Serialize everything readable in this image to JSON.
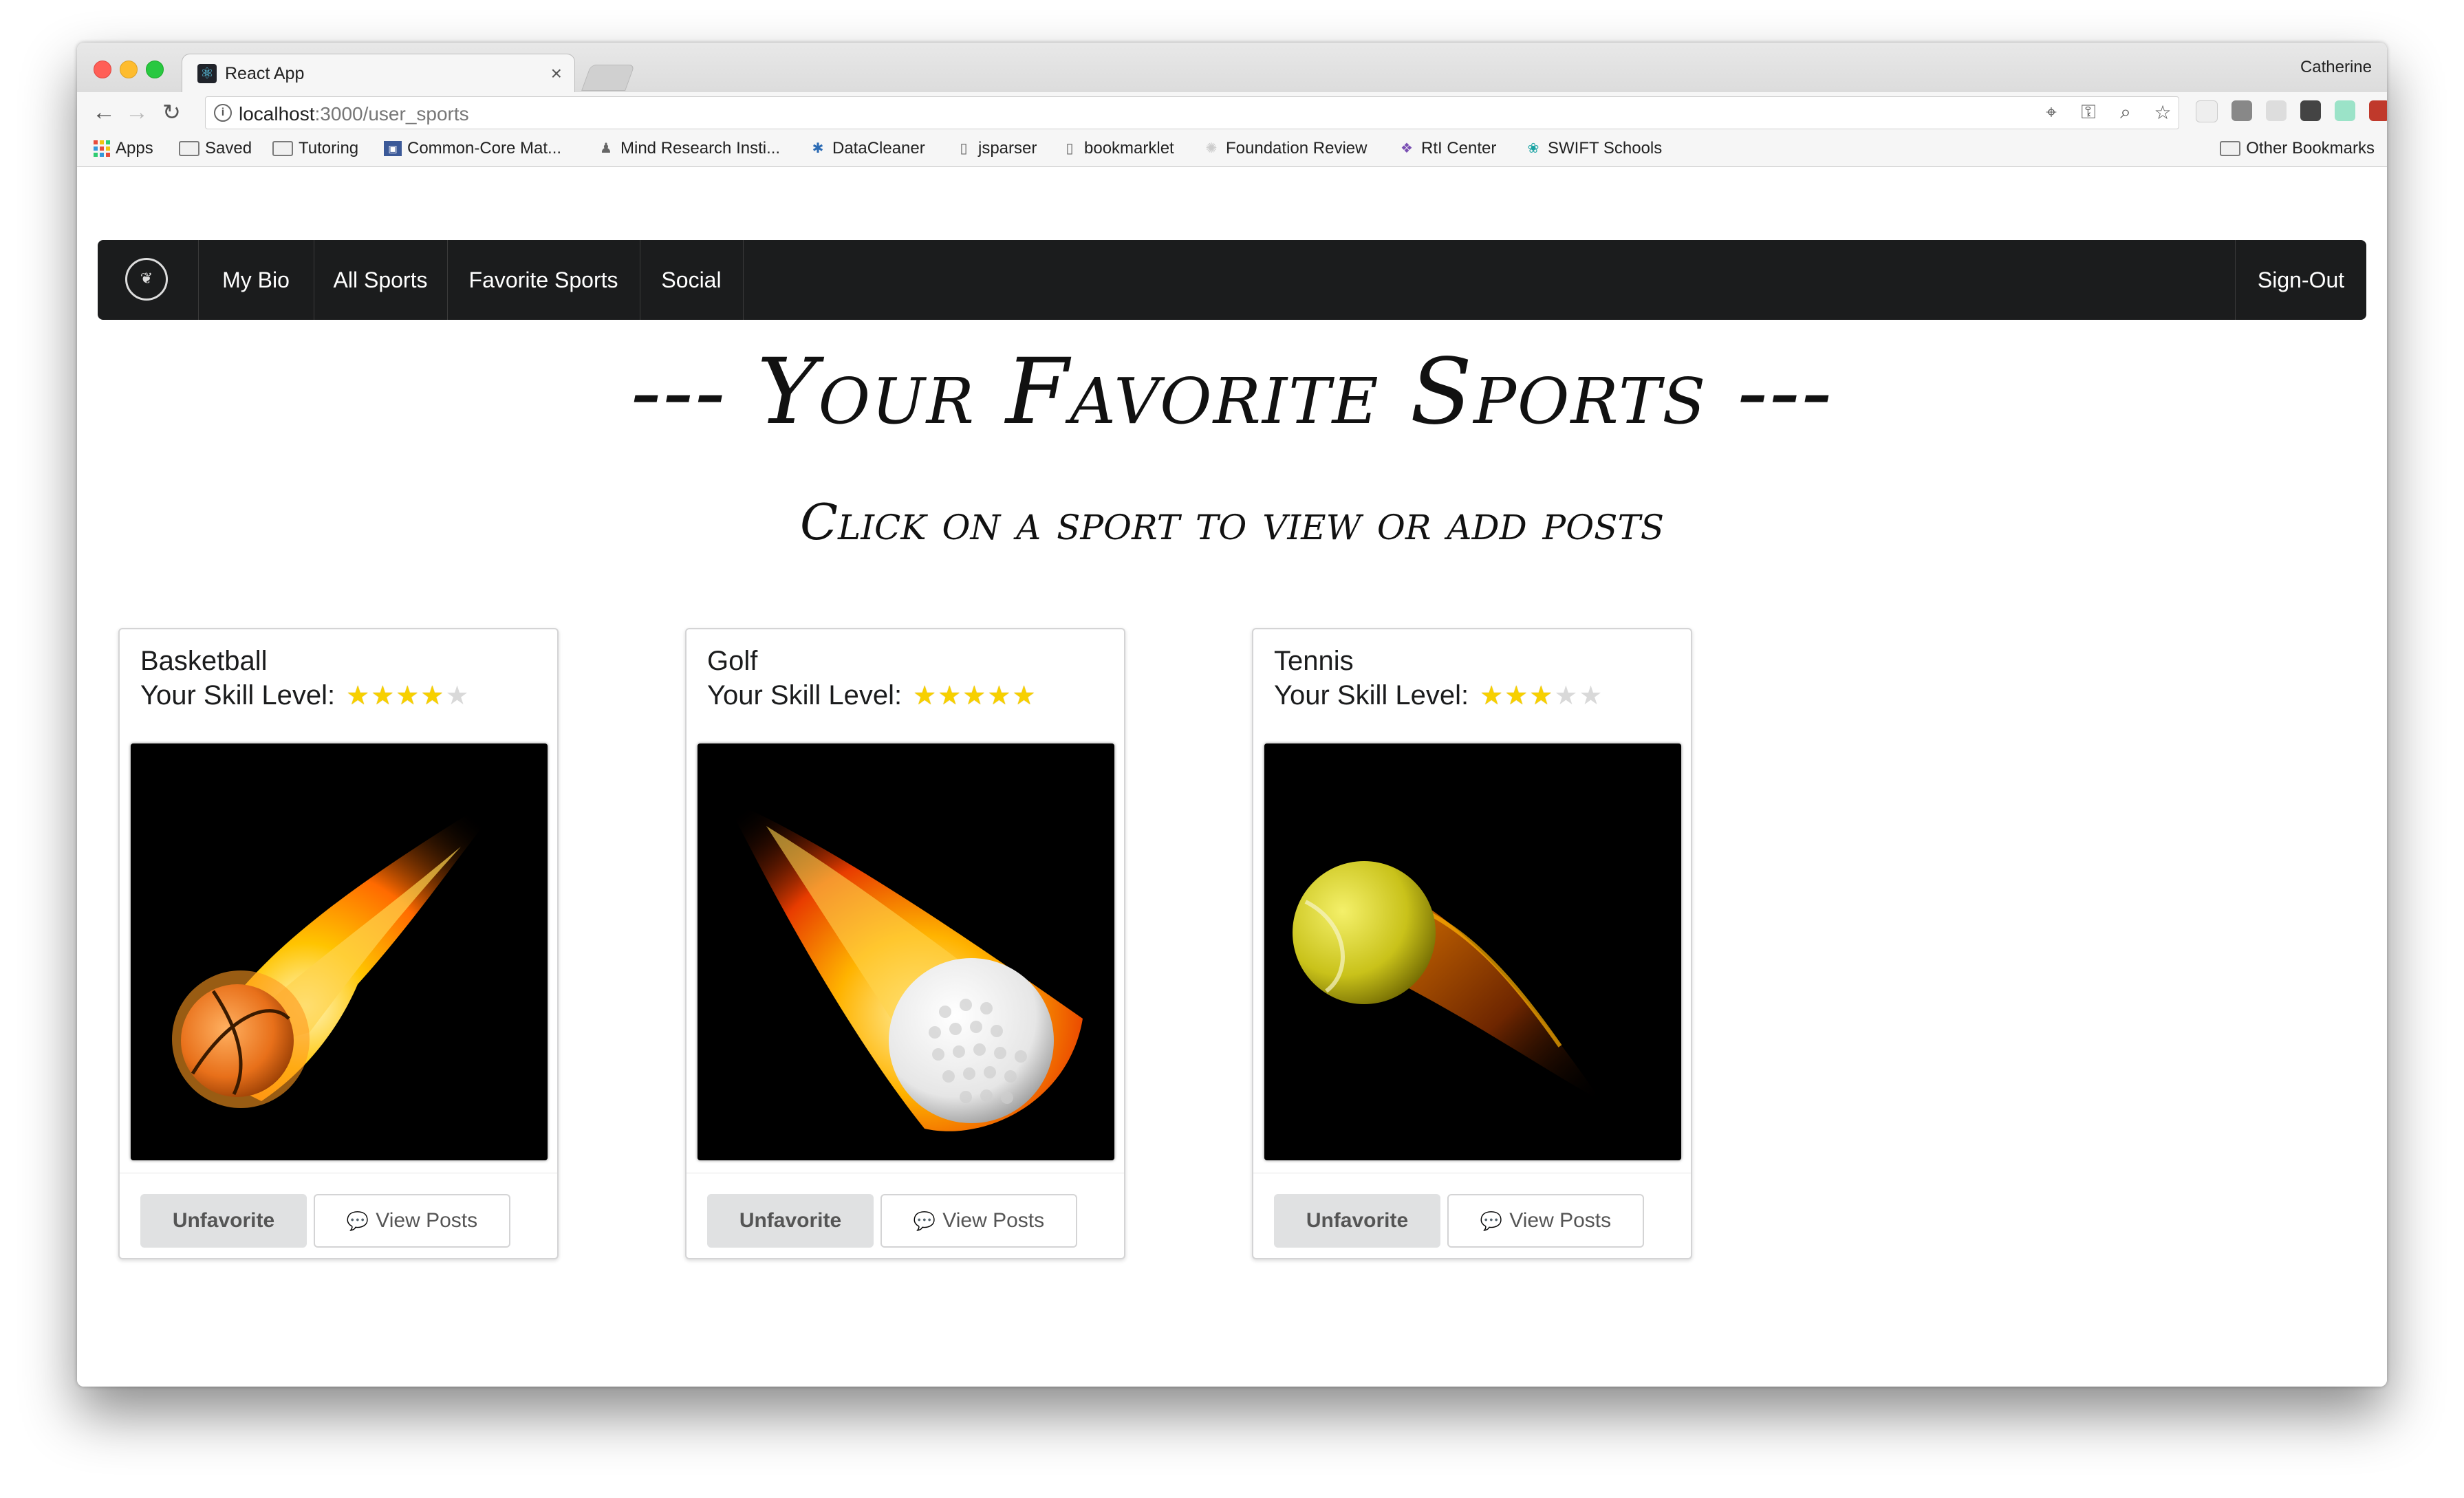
{
  "browser": {
    "tab_title": "React App",
    "tab_close": "×",
    "profile_name": "Catherine",
    "url_host": "localhost",
    "url_path": ":3000/user_sports",
    "info_glyph": "i"
  },
  "bookmarks": [
    {
      "label": "Apps",
      "icon": "apps-grid-icon"
    },
    {
      "label": "Saved",
      "icon": "folder-icon"
    },
    {
      "label": "Tutoring",
      "icon": "folder-icon"
    },
    {
      "label": "Common-Core Mat...",
      "icon": "site-icon"
    },
    {
      "label": "Mind Research Insti...",
      "icon": "site-icon"
    },
    {
      "label": "DataCleaner",
      "icon": "site-icon"
    },
    {
      "label": "jsparser",
      "icon": "page-icon"
    },
    {
      "label": "bookmarklet",
      "icon": "page-icon"
    },
    {
      "label": "Foundation Review",
      "icon": "site-icon"
    },
    {
      "label": "RtI Center",
      "icon": "site-icon"
    },
    {
      "label": "SWIFT Schools",
      "icon": "site-icon"
    }
  ],
  "other_bookmarks": "Other Bookmarks",
  "navbar": {
    "items": [
      "My Bio",
      "All Sports",
      "Favorite Sports",
      "Social"
    ],
    "signout": "Sign-Out"
  },
  "page": {
    "heading": "--- Your Favorite Sports ---",
    "subheading": "Click on a sport to view or add posts"
  },
  "cards": [
    {
      "sport": "Basketball",
      "skill_label": "Your Skill Level:",
      "rating": 4,
      "max_rating": 5,
      "ball": "basketball",
      "unfavorite": "Unfavorite",
      "view_posts": "View Posts"
    },
    {
      "sport": "Golf",
      "skill_label": "Your Skill Level:",
      "rating": 5,
      "max_rating": 5,
      "ball": "golf",
      "unfavorite": "Unfavorite",
      "view_posts": "View Posts"
    },
    {
      "sport": "Tennis",
      "skill_label": "Your Skill Level:",
      "rating": 3,
      "max_rating": 5,
      "ball": "tennis",
      "unfavorite": "Unfavorite",
      "view_posts": "View Posts"
    }
  ],
  "colors": {
    "navbar_bg": "#1b1c1d",
    "star_active": "#f7d000",
    "star_inactive": "#d9d9d9",
    "button_grey": "#e0e1e2"
  }
}
